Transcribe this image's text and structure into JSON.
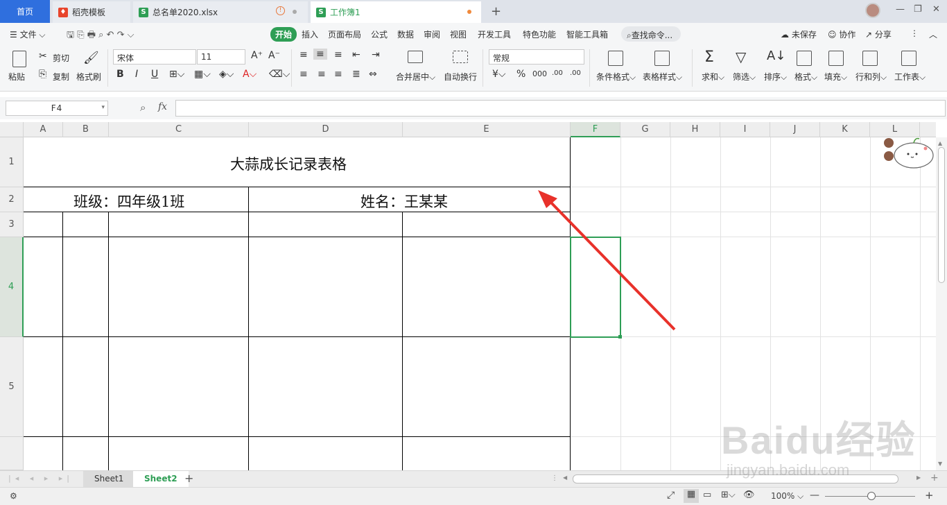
{
  "tabs": {
    "home": "首页",
    "t1": "稻壳模板",
    "t2": "总名单2020.xlsx",
    "t3": "工作簿1"
  },
  "menu": {
    "file": "文件",
    "items": [
      "开始",
      "插入",
      "页面布局",
      "公式",
      "数据",
      "审阅",
      "视图",
      "开发工具",
      "特色功能",
      "智能工具箱"
    ],
    "search": "查找命令...",
    "unsaved": "未保存",
    "collab": "协作",
    "share": "分享"
  },
  "ribbon": {
    "paste": "粘贴",
    "cut": "剪切",
    "copy": "复制",
    "format_painter": "格式刷",
    "font": "宋体",
    "size": "11",
    "merge": "合并居中",
    "wrap": "自动换行",
    "numfmt": "常规",
    "cond_format": "条件格式",
    "table_style": "表格样式",
    "sum": "求和",
    "filter": "筛选",
    "sort": "排序",
    "format": "格式",
    "fill": "填充",
    "rowcol": "行和列",
    "sheet": "工作表"
  },
  "formula_bar": {
    "cell_ref": "F4",
    "fx": "fx",
    "value": ""
  },
  "columns": [
    "A",
    "B",
    "C",
    "D",
    "E",
    "F",
    "G",
    "H",
    "I",
    "J",
    "K",
    "L"
  ],
  "rows": [
    "1",
    "2",
    "3",
    "4",
    "5"
  ],
  "cells": {
    "title": "大蒜成长记录表格",
    "class": "班级：四年级1班",
    "name": "姓名：王某某"
  },
  "sheets": [
    "Sheet1",
    "Sheet2"
  ],
  "status": {
    "zoom": "100%"
  },
  "watermark": {
    "main": "Baidu经验",
    "sub": "jingyan.baidu.com"
  },
  "colors": {
    "accent": "#2e9e55",
    "home_tab": "#2f6fde",
    "arrow": "#e8312a"
  }
}
